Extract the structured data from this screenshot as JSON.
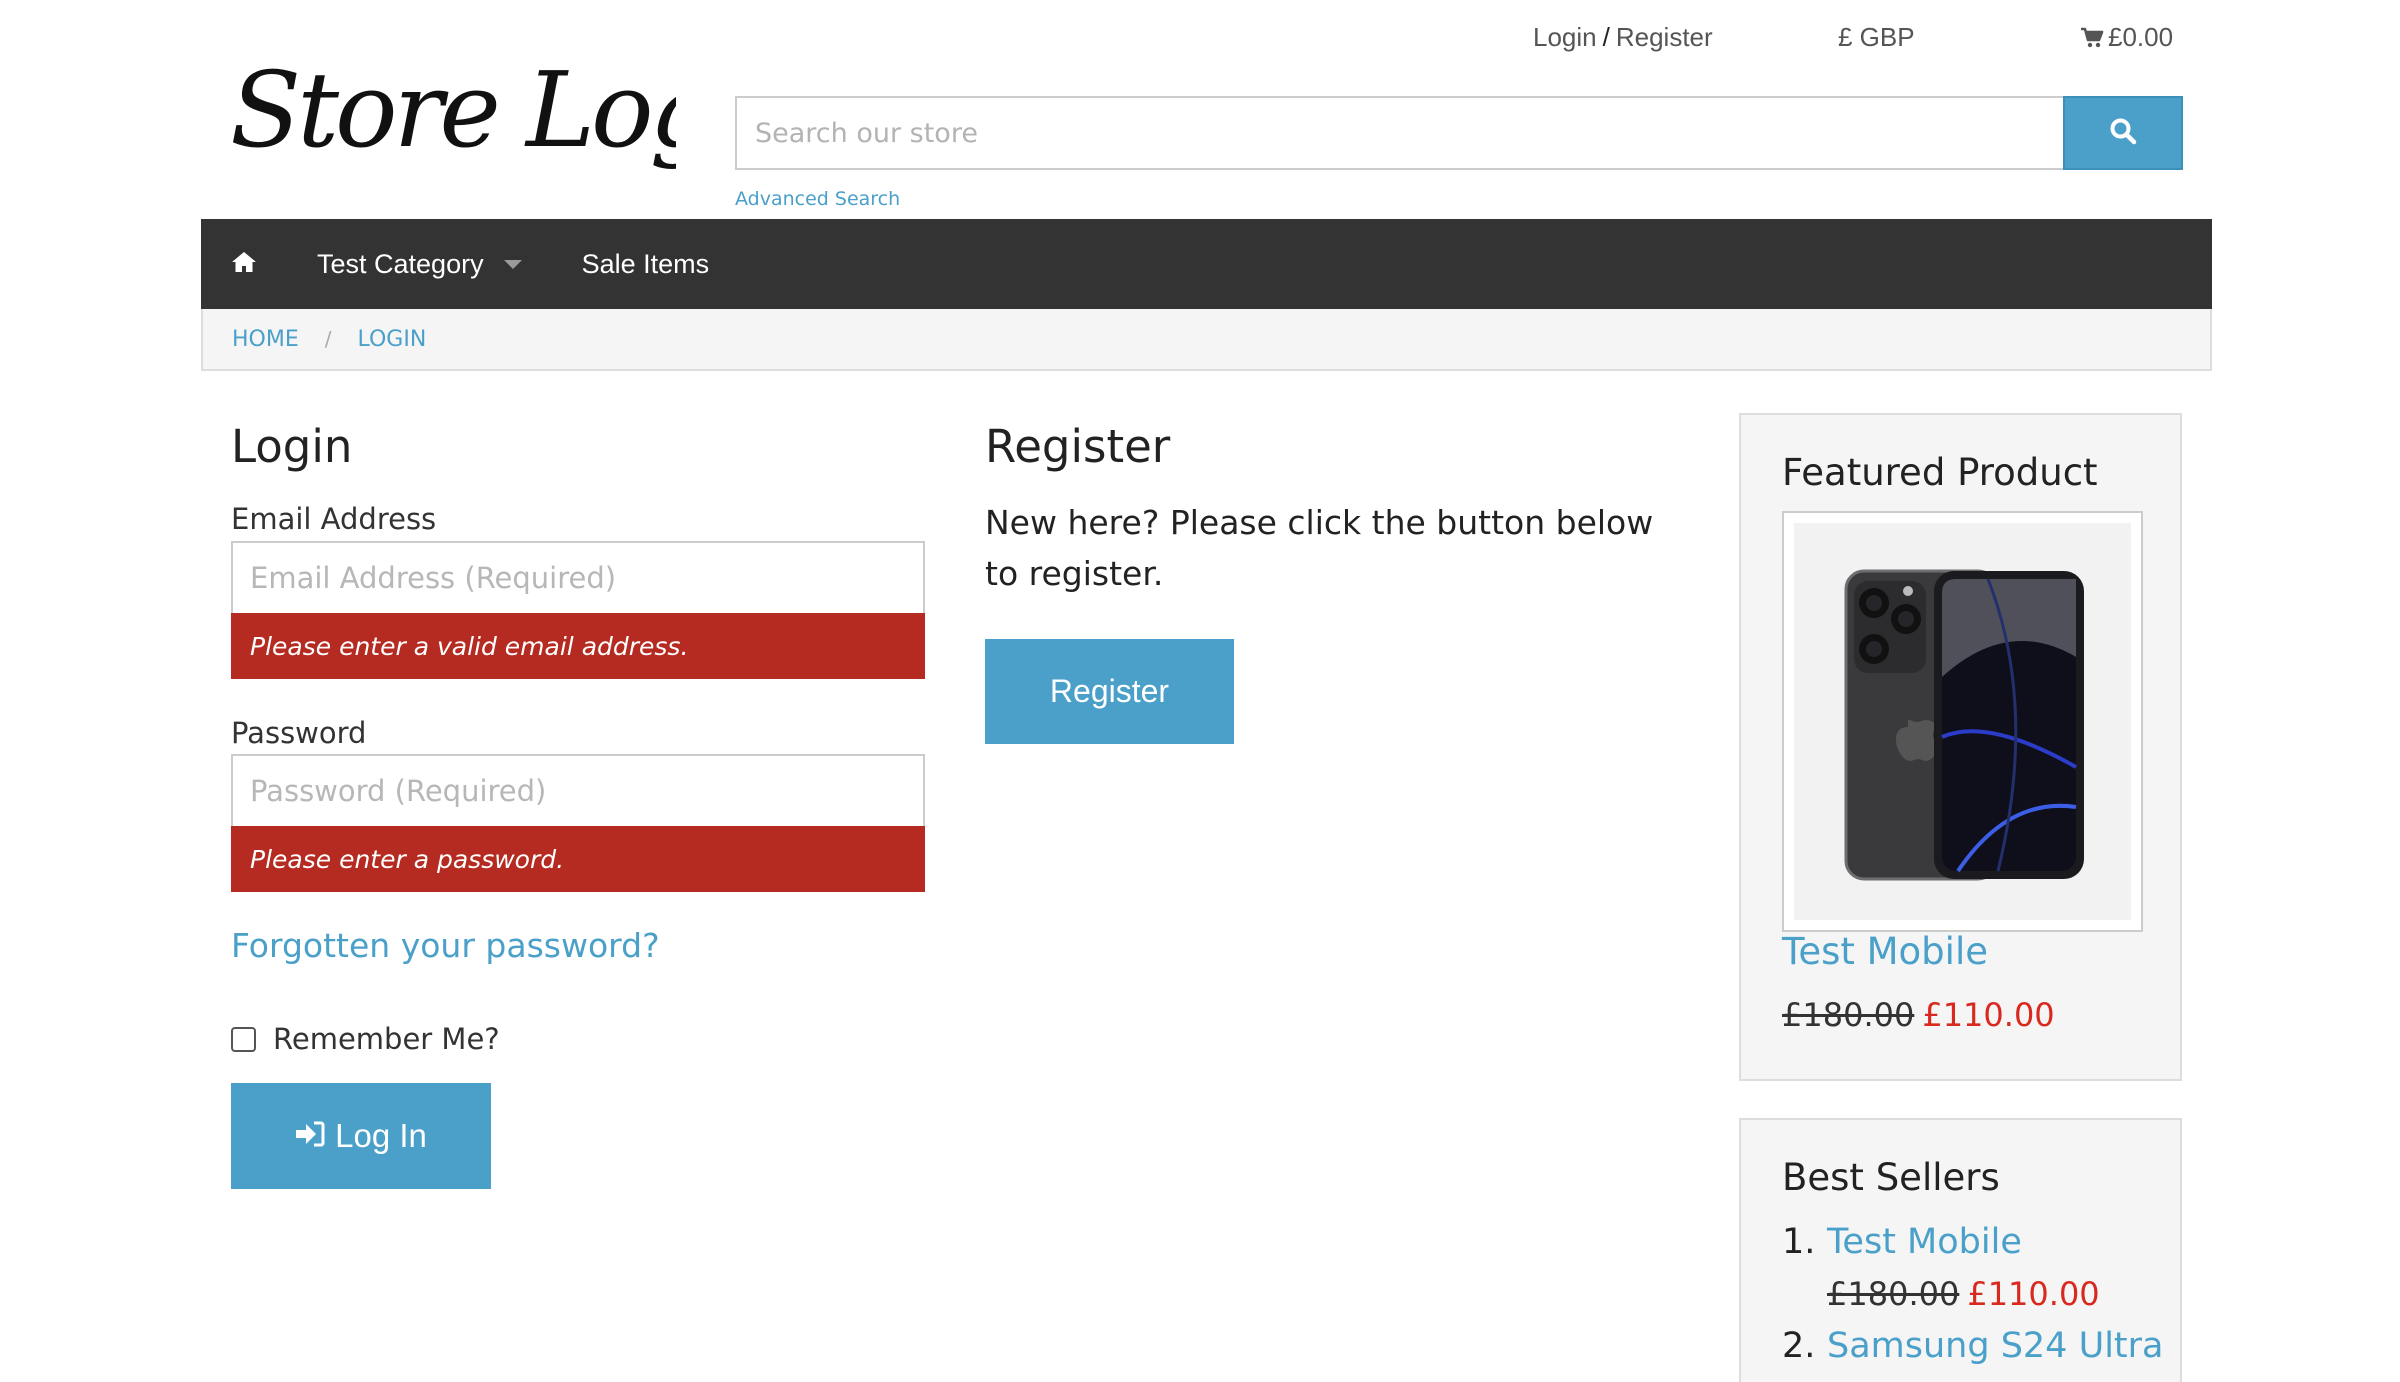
{
  "header": {
    "login_label": "Login",
    "slash": "/",
    "register_label": "Register",
    "currency": "£ GBP",
    "cart_total": "£0.00",
    "logo_text": "Store Logo",
    "search_placeholder": "Search our store",
    "advanced_search": "Advanced Search"
  },
  "nav": {
    "items": [
      {
        "label": "Test Category"
      },
      {
        "label": "Sale Items"
      }
    ]
  },
  "breadcrumb": [
    "HOME",
    "LOGIN"
  ],
  "login": {
    "title": "Login",
    "email_label": "Email Address",
    "email_placeholder": "Email Address (Required)",
    "email_error": "Please enter a valid email address.",
    "password_label": "Password",
    "password_placeholder": "Password (Required)",
    "password_error": "Please enter a password.",
    "forgot": "Forgotten your password?",
    "remember": "Remember Me?",
    "button": "Log In"
  },
  "register": {
    "title": "Register",
    "text": "New here? Please click the button below to register.",
    "button": "Register"
  },
  "featured": {
    "title": "Featured Product",
    "name": "Test Mobile",
    "old_price": "£180.00",
    "new_price": "£110.00"
  },
  "best_sellers": {
    "title": "Best Sellers",
    "items": [
      {
        "num": "1.",
        "name": "Test Mobile",
        "old_price": "£180.00",
        "new_price": "£110.00"
      },
      {
        "num": "2.",
        "name": "Samsung S24 Ultra"
      }
    ]
  },
  "colors": {
    "accent": "#4aa0c9",
    "navbar": "#333333",
    "error": "#b52a21",
    "sale_price": "#d9291f"
  }
}
